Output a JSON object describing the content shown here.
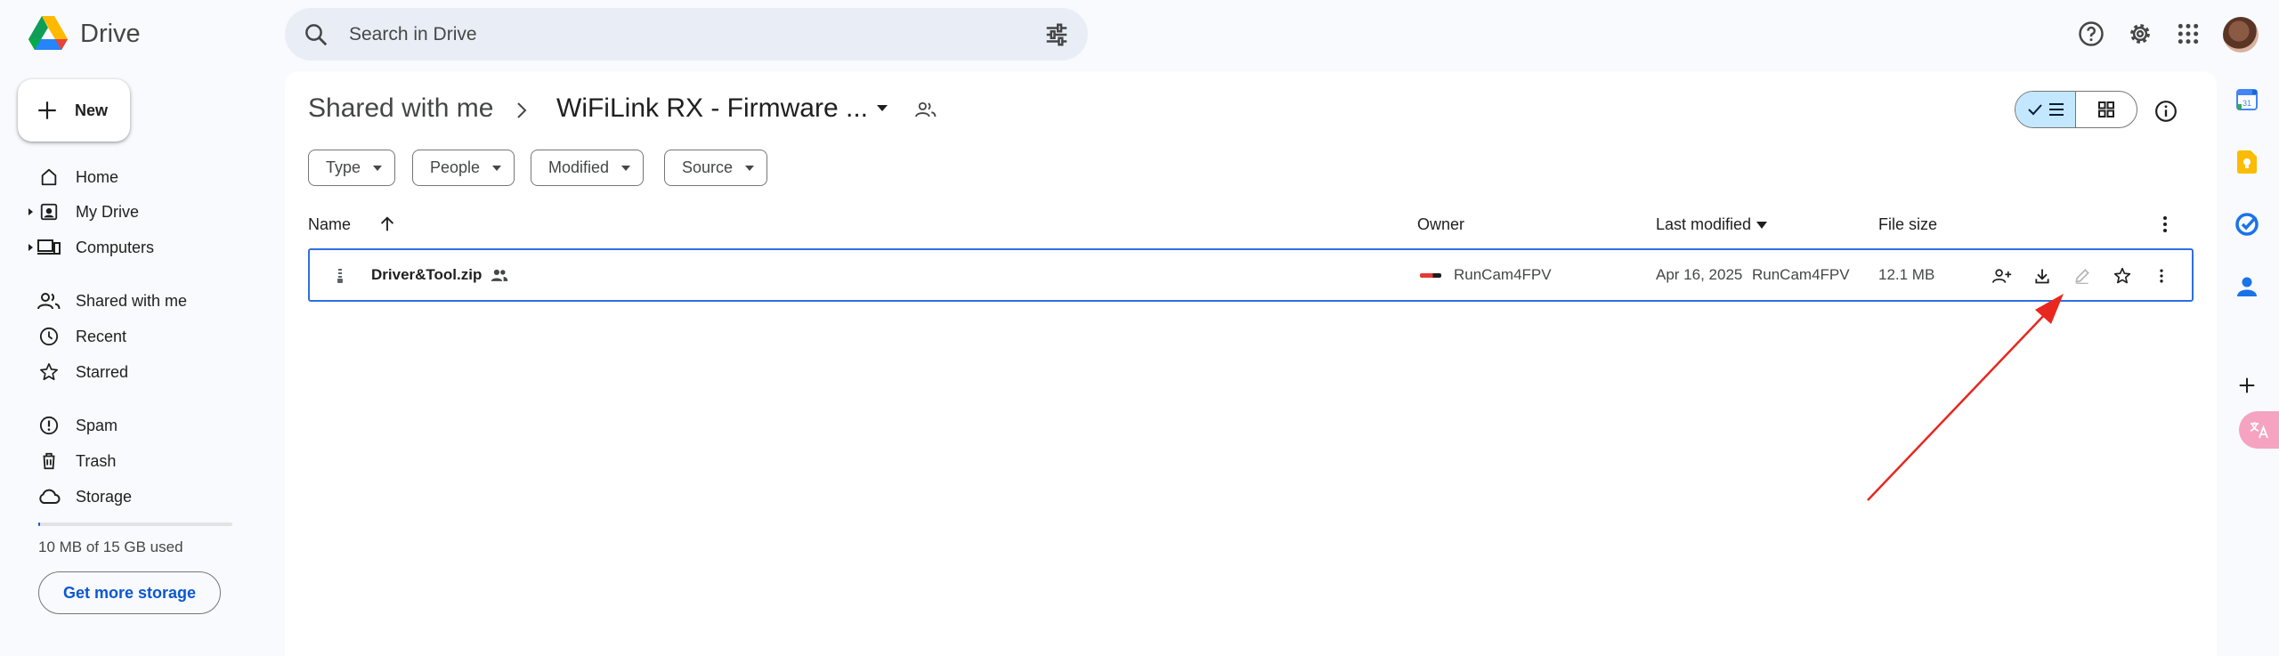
{
  "app": {
    "name": "Drive"
  },
  "search": {
    "placeholder": "Search in Drive"
  },
  "sidebar": {
    "new_label": "New",
    "items": [
      {
        "label": "Home"
      },
      {
        "label": "My Drive"
      },
      {
        "label": "Computers"
      },
      {
        "label": "Shared with me"
      },
      {
        "label": "Recent"
      },
      {
        "label": "Starred"
      },
      {
        "label": "Spam"
      },
      {
        "label": "Trash"
      },
      {
        "label": "Storage"
      }
    ],
    "storage_used": "10 MB of 15 GB used",
    "storage_fraction": 0.0007,
    "get_storage_label": "Get more storage"
  },
  "breadcrumb": {
    "parent": "Shared with me",
    "current": "WiFiLink RX - Firmware ..."
  },
  "filters": [
    {
      "label": "Type"
    },
    {
      "label": "People"
    },
    {
      "label": "Modified"
    },
    {
      "label": "Source"
    }
  ],
  "columns": {
    "name": "Name",
    "owner": "Owner",
    "last_modified": "Last modified",
    "file_size": "File size"
  },
  "files": [
    {
      "name": "Driver&Tool.zip",
      "owner": "RunCam4FPV",
      "modified_date": "Apr 16, 2025",
      "modified_by": "RunCam4FPV",
      "size": "12.1 MB"
    }
  ],
  "colors": {
    "accent": "#0b57d0",
    "selected_view": "#c2e7ff",
    "row_border": "#2f6fe0",
    "annotation_arrow": "#e8271f"
  }
}
